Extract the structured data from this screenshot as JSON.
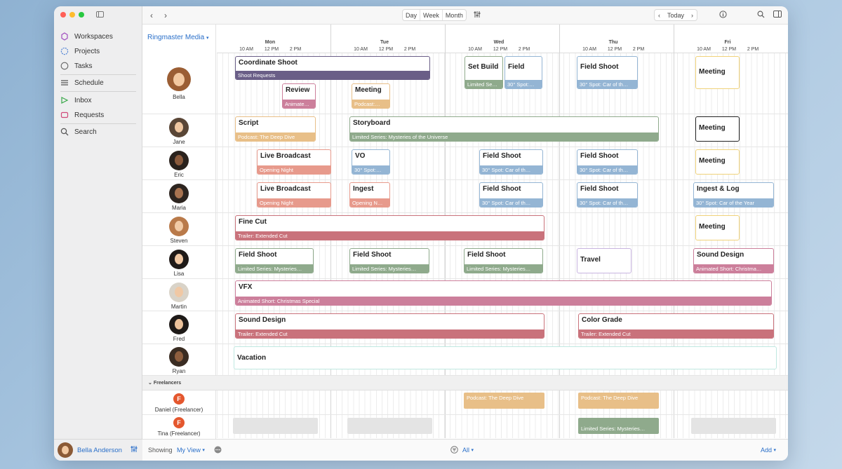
{
  "window": {
    "sidebar_items": [
      {
        "label": "Workspaces",
        "icon": "workspaces-icon"
      },
      {
        "label": "Projects",
        "icon": "projects-icon"
      },
      {
        "label": "Tasks",
        "icon": "tasks-icon"
      },
      {
        "label": "Schedule",
        "icon": "schedule-icon"
      },
      {
        "label": "Inbox",
        "icon": "inbox-icon"
      },
      {
        "label": "Requests",
        "icon": "requests-icon"
      },
      {
        "label": "Search",
        "icon": "search-icon"
      }
    ],
    "user": "Bella Anderson"
  },
  "toolbar": {
    "views": [
      "Day",
      "Week",
      "Month"
    ],
    "today": "Today"
  },
  "org": "Ringmaster Media",
  "days": [
    "Mon",
    "Tue",
    "Wed",
    "Thu",
    "Fri"
  ],
  "hours": [
    "10 AM",
    "12 PM",
    "2 PM"
  ],
  "people": [
    "Bella",
    "Jane",
    "Eric",
    "Maria",
    "Steven",
    "Lisa",
    "Martin",
    "Fred",
    "Ryan"
  ],
  "freelancers_label": "Freelancers",
  "freelancers": [
    {
      "name": "Daniel (Freelancer)",
      "initial": "F"
    },
    {
      "name": "Tina (Freelancer)",
      "initial": "F"
    }
  ],
  "events": [
    {
      "title": "Coordinate Shoot",
      "sub": "Shoot Requests",
      "color": "#6a5e87"
    },
    {
      "title": "Review",
      "sub": "Animate…",
      "color": "#cc7f9b"
    },
    {
      "title": "Meeting",
      "sub": "Podcast:…",
      "color": "#e8bf88"
    },
    {
      "title": "Set Build",
      "sub": "Limited Se…",
      "color": "#8faa8c"
    },
    {
      "title": "Field",
      "sub": "30° Spot:…",
      "color": "#94b5d4"
    },
    {
      "title": "Field Shoot",
      "sub": "30° Spot: Car of th…",
      "color": "#94b5d4"
    },
    {
      "title": "Meeting",
      "sub": "",
      "color": "#f0d27a"
    },
    {
      "title": "Script",
      "sub": "Podcast: The Deep Dive",
      "color": "#e8bf88"
    },
    {
      "title": "Storyboard",
      "sub": "Limited Series: Mysteries of the Universe",
      "color": "#8faa8c"
    },
    {
      "title": "Meeting",
      "sub": "",
      "color": "#f0d27a"
    },
    {
      "title": "Live Broadcast",
      "sub": "Opening Night",
      "color": "#e79a8c"
    },
    {
      "title": "VO",
      "sub": "30° Spot:…",
      "color": "#94b5d4"
    },
    {
      "title": "Field Shoot",
      "sub": "30° Spot: Car of th…",
      "color": "#94b5d4"
    },
    {
      "title": "Field Shoot",
      "sub": "30° Spot: Car of th…",
      "color": "#94b5d4"
    },
    {
      "title": "Meeting",
      "sub": "",
      "color": "#f0d27a"
    },
    {
      "title": "Live Broadcast",
      "sub": "Opening Night",
      "color": "#e79a8c"
    },
    {
      "title": "Ingest",
      "sub": "Opening N…",
      "color": "#e79a8c"
    },
    {
      "title": "Field Shoot",
      "sub": "30° Spot: Car of th…",
      "color": "#94b5d4"
    },
    {
      "title": "Field Shoot",
      "sub": "30° Spot: Car of th…",
      "color": "#94b5d4"
    },
    {
      "title": "Ingest & Log",
      "sub": "30° Spot: Car of the Year",
      "color": "#94b5d4"
    },
    {
      "title": "Fine Cut",
      "sub": "Trailer: Extended Cut",
      "color": "#c9727b"
    },
    {
      "title": "Meeting",
      "sub": "",
      "color": "#f0d27a"
    },
    {
      "title": "Field Shoot",
      "sub": "Limited Series: Mysteries…",
      "color": "#8faa8c"
    },
    {
      "title": "Field Shoot",
      "sub": "Limited Series: Mysteries…",
      "color": "#8faa8c"
    },
    {
      "title": "Field Shoot",
      "sub": "Limited Series: Mysteries…",
      "color": "#8faa8c"
    },
    {
      "title": "Travel",
      "sub": "",
      "color": "#c8b4e0"
    },
    {
      "title": "Sound Design",
      "sub": "Animated Short: Christma…",
      "color": "#cc7f9b"
    },
    {
      "title": "VFX",
      "sub": "Animated Short: Christmas Special",
      "color": "#cc7f9b"
    },
    {
      "title": "Sound Design",
      "sub": "Trailer: Extended Cut",
      "color": "#c9727b"
    },
    {
      "title": "Color Grade",
      "sub": "Trailer: Extended Cut",
      "color": "#c9727b"
    },
    {
      "title": "Vacation",
      "sub": "",
      "color": "#bfe8e0"
    }
  ],
  "freelance_events": [
    {
      "sub": "Podcast: The Deep Dive",
      "color": "#e8bf88"
    },
    {
      "sub": "Podcast: The Deep Dive",
      "color": "#e8bf88"
    },
    {
      "sub": "Limited Series: Mysteries…",
      "color": "#8faa8c"
    }
  ],
  "bottom": {
    "showing": "Showing",
    "view": "My View",
    "filter": "All",
    "add": "Add"
  }
}
